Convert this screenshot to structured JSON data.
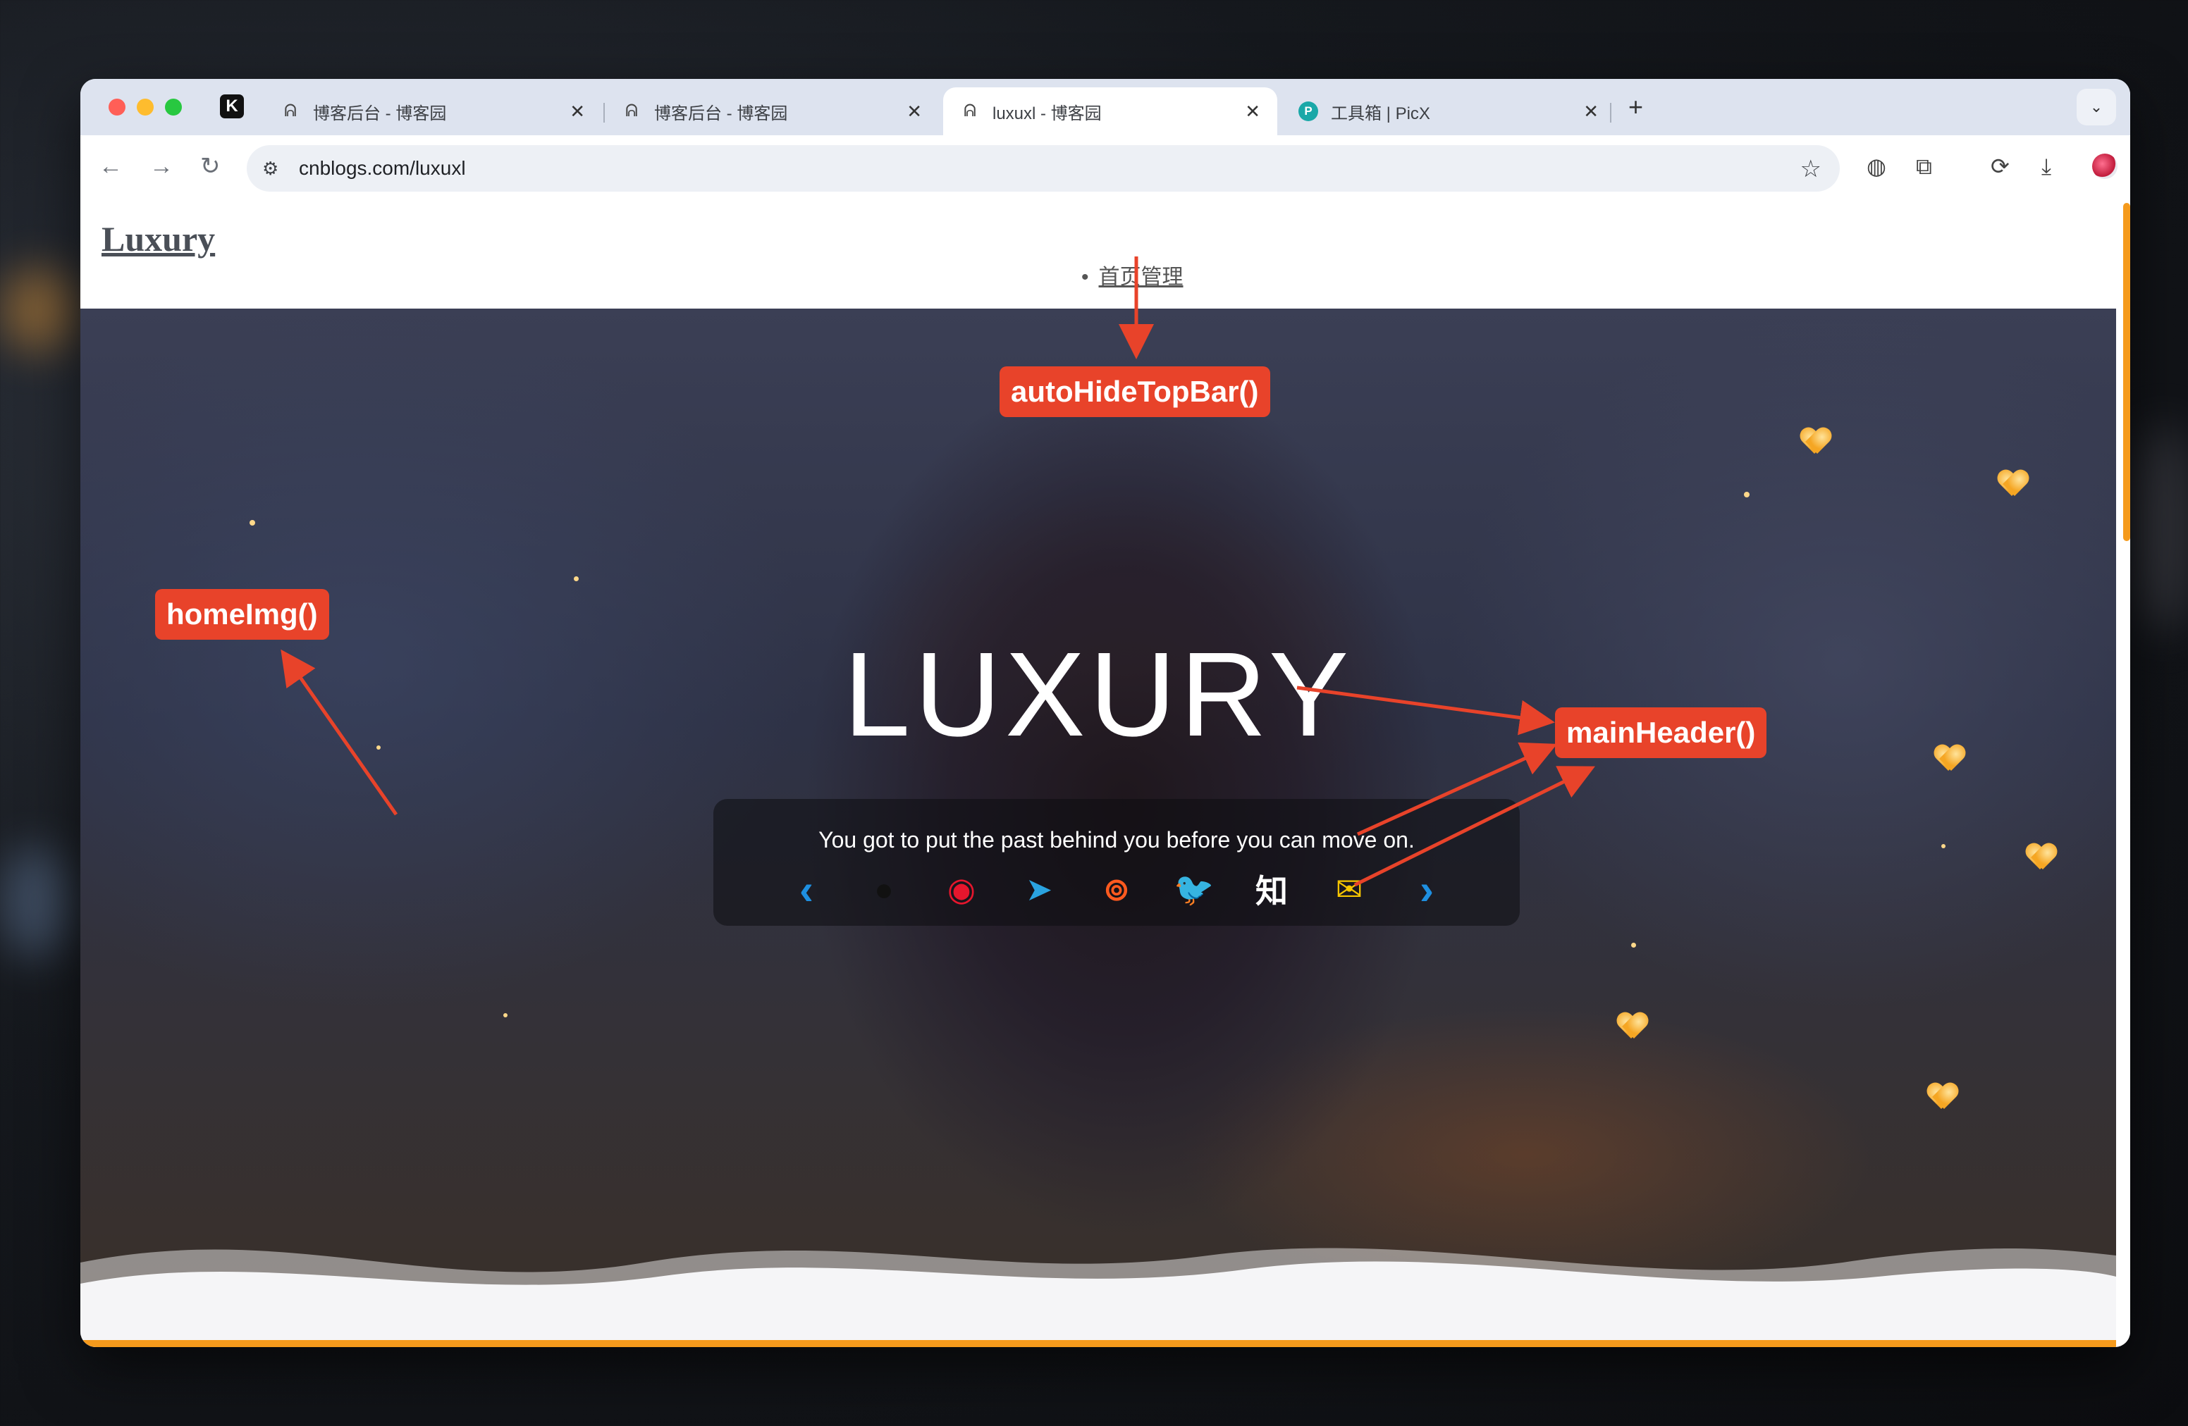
{
  "browser": {
    "pinned_tab_label": "K",
    "tabs": [
      {
        "title": "博客后台 - 博客园",
        "favicon": "cnblogs-icon",
        "active": false
      },
      {
        "title": "博客后台 - 博客园",
        "favicon": "cnblogs-icon",
        "active": false
      },
      {
        "title": "luxuxl - 博客园",
        "favicon": "cnblogs-icon",
        "active": true
      },
      {
        "title": "工具箱 | PicX",
        "favicon": "picx-icon",
        "active": false
      }
    ],
    "new_tab_label": "+",
    "address": "cnblogs.com/luxuxl"
  },
  "site": {
    "logo": "Luxury",
    "nav_items": [
      {
        "label": "首页管理"
      }
    ]
  },
  "hero": {
    "title": "LUXURY",
    "quote": "You got to put the past behind you before you can move on.",
    "social_icons": [
      "prev-arrow-icon",
      "github-icon",
      "weibo-icon",
      "telegram-icon",
      "netease-music-icon",
      "twitter-icon",
      "zhihu-icon",
      "mail-icon",
      "next-arrow-icon"
    ],
    "social_glyphs": {
      "prev": "‹",
      "github": "●",
      "weibo": "◉",
      "telegram": "➤",
      "netease": "⊚",
      "twitter": "🐦",
      "zhihu": "知",
      "mail": "✉",
      "next": "›"
    }
  },
  "annotations": {
    "top_bar": "autoHideTopBar()",
    "home_img": "homeImg()",
    "main_header": "mainHeader()"
  },
  "colors": {
    "accent": "#f59a1c",
    "annotation": "#e8432a",
    "tab_strip": "#dde3ef"
  }
}
